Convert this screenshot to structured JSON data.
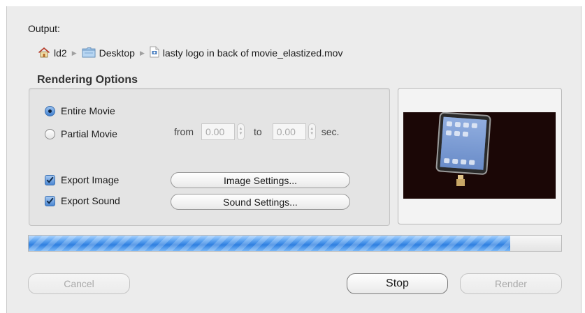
{
  "output": {
    "label": "Output:",
    "path": [
      {
        "name": "ld2",
        "icon": "home-icon"
      },
      {
        "name": "Desktop",
        "icon": "folder-icon"
      },
      {
        "name": "lasty logo in back of movie_elastized.mov",
        "icon": "movie-file-icon"
      }
    ]
  },
  "rendering": {
    "title": "Rendering Options",
    "entire_movie_label": "Entire Movie",
    "entire_movie_selected": true,
    "partial_movie_label": "Partial Movie",
    "partial_movie_selected": false,
    "from_label": "from",
    "from_value": "0.00",
    "to_label": "to",
    "to_value": "0.00",
    "unit_label": "sec.",
    "export_image_label": "Export Image",
    "export_image_checked": true,
    "export_sound_label": "Export Sound",
    "export_sound_checked": true,
    "image_settings_label": "Image Settings...",
    "sound_settings_label": "Sound Settings..."
  },
  "progress": {
    "fraction": 0.904
  },
  "buttons": {
    "cancel_label": "Cancel",
    "stop_label": "Stop",
    "render_label": "Render"
  },
  "colors": {
    "accent": "#3f7fcf",
    "progress_blue": "#2f7fe0",
    "window_bg": "#ececec",
    "preview_bg": "#1b0706"
  }
}
